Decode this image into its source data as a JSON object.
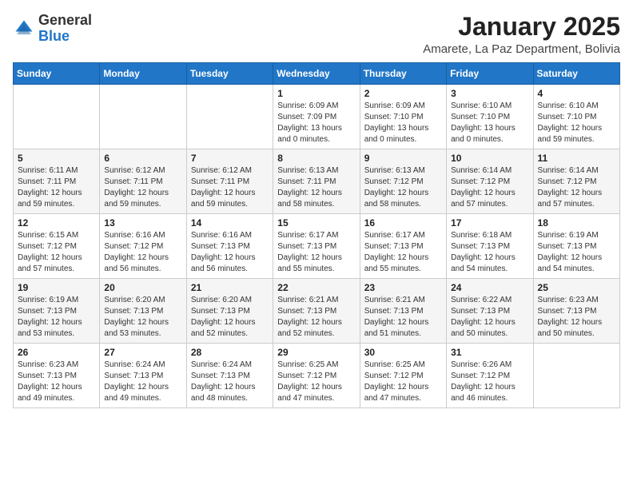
{
  "header": {
    "logo_general": "General",
    "logo_blue": "Blue",
    "month_title": "January 2025",
    "subtitle": "Amarete, La Paz Department, Bolivia"
  },
  "calendar": {
    "days_of_week": [
      "Sunday",
      "Monday",
      "Tuesday",
      "Wednesday",
      "Thursday",
      "Friday",
      "Saturday"
    ],
    "weeks": [
      [
        {
          "day": "",
          "info": ""
        },
        {
          "day": "",
          "info": ""
        },
        {
          "day": "",
          "info": ""
        },
        {
          "day": "1",
          "info": "Sunrise: 6:09 AM\nSunset: 7:09 PM\nDaylight: 13 hours\nand 0 minutes."
        },
        {
          "day": "2",
          "info": "Sunrise: 6:09 AM\nSunset: 7:10 PM\nDaylight: 13 hours\nand 0 minutes."
        },
        {
          "day": "3",
          "info": "Sunrise: 6:10 AM\nSunset: 7:10 PM\nDaylight: 13 hours\nand 0 minutes."
        },
        {
          "day": "4",
          "info": "Sunrise: 6:10 AM\nSunset: 7:10 PM\nDaylight: 12 hours\nand 59 minutes."
        }
      ],
      [
        {
          "day": "5",
          "info": "Sunrise: 6:11 AM\nSunset: 7:11 PM\nDaylight: 12 hours\nand 59 minutes."
        },
        {
          "day": "6",
          "info": "Sunrise: 6:12 AM\nSunset: 7:11 PM\nDaylight: 12 hours\nand 59 minutes."
        },
        {
          "day": "7",
          "info": "Sunrise: 6:12 AM\nSunset: 7:11 PM\nDaylight: 12 hours\nand 59 minutes."
        },
        {
          "day": "8",
          "info": "Sunrise: 6:13 AM\nSunset: 7:11 PM\nDaylight: 12 hours\nand 58 minutes."
        },
        {
          "day": "9",
          "info": "Sunrise: 6:13 AM\nSunset: 7:12 PM\nDaylight: 12 hours\nand 58 minutes."
        },
        {
          "day": "10",
          "info": "Sunrise: 6:14 AM\nSunset: 7:12 PM\nDaylight: 12 hours\nand 57 minutes."
        },
        {
          "day": "11",
          "info": "Sunrise: 6:14 AM\nSunset: 7:12 PM\nDaylight: 12 hours\nand 57 minutes."
        }
      ],
      [
        {
          "day": "12",
          "info": "Sunrise: 6:15 AM\nSunset: 7:12 PM\nDaylight: 12 hours\nand 57 minutes."
        },
        {
          "day": "13",
          "info": "Sunrise: 6:16 AM\nSunset: 7:12 PM\nDaylight: 12 hours\nand 56 minutes."
        },
        {
          "day": "14",
          "info": "Sunrise: 6:16 AM\nSunset: 7:13 PM\nDaylight: 12 hours\nand 56 minutes."
        },
        {
          "day": "15",
          "info": "Sunrise: 6:17 AM\nSunset: 7:13 PM\nDaylight: 12 hours\nand 55 minutes."
        },
        {
          "day": "16",
          "info": "Sunrise: 6:17 AM\nSunset: 7:13 PM\nDaylight: 12 hours\nand 55 minutes."
        },
        {
          "day": "17",
          "info": "Sunrise: 6:18 AM\nSunset: 7:13 PM\nDaylight: 12 hours\nand 54 minutes."
        },
        {
          "day": "18",
          "info": "Sunrise: 6:19 AM\nSunset: 7:13 PM\nDaylight: 12 hours\nand 54 minutes."
        }
      ],
      [
        {
          "day": "19",
          "info": "Sunrise: 6:19 AM\nSunset: 7:13 PM\nDaylight: 12 hours\nand 53 minutes."
        },
        {
          "day": "20",
          "info": "Sunrise: 6:20 AM\nSunset: 7:13 PM\nDaylight: 12 hours\nand 53 minutes."
        },
        {
          "day": "21",
          "info": "Sunrise: 6:20 AM\nSunset: 7:13 PM\nDaylight: 12 hours\nand 52 minutes."
        },
        {
          "day": "22",
          "info": "Sunrise: 6:21 AM\nSunset: 7:13 PM\nDaylight: 12 hours\nand 52 minutes."
        },
        {
          "day": "23",
          "info": "Sunrise: 6:21 AM\nSunset: 7:13 PM\nDaylight: 12 hours\nand 51 minutes."
        },
        {
          "day": "24",
          "info": "Sunrise: 6:22 AM\nSunset: 7:13 PM\nDaylight: 12 hours\nand 50 minutes."
        },
        {
          "day": "25",
          "info": "Sunrise: 6:23 AM\nSunset: 7:13 PM\nDaylight: 12 hours\nand 50 minutes."
        }
      ],
      [
        {
          "day": "26",
          "info": "Sunrise: 6:23 AM\nSunset: 7:13 PM\nDaylight: 12 hours\nand 49 minutes."
        },
        {
          "day": "27",
          "info": "Sunrise: 6:24 AM\nSunset: 7:13 PM\nDaylight: 12 hours\nand 49 minutes."
        },
        {
          "day": "28",
          "info": "Sunrise: 6:24 AM\nSunset: 7:13 PM\nDaylight: 12 hours\nand 48 minutes."
        },
        {
          "day": "29",
          "info": "Sunrise: 6:25 AM\nSunset: 7:12 PM\nDaylight: 12 hours\nand 47 minutes."
        },
        {
          "day": "30",
          "info": "Sunrise: 6:25 AM\nSunset: 7:12 PM\nDaylight: 12 hours\nand 47 minutes."
        },
        {
          "day": "31",
          "info": "Sunrise: 6:26 AM\nSunset: 7:12 PM\nDaylight: 12 hours\nand 46 minutes."
        },
        {
          "day": "",
          "info": ""
        }
      ]
    ]
  }
}
